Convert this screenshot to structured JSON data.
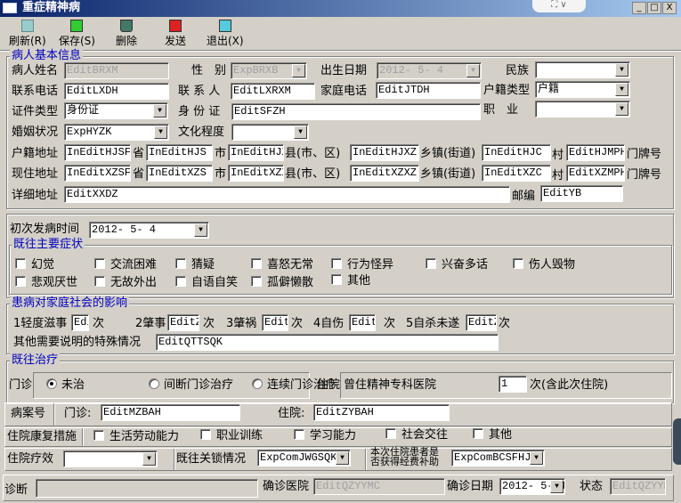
{
  "window": {
    "title": "重症精神病",
    "controls": [
      "_",
      "□",
      "X"
    ]
  },
  "toolbar": [
    {
      "label": "刷新(R)",
      "icon": "refresh-icon"
    },
    {
      "label": "保存(S)",
      "icon": "save-icon"
    },
    {
      "label": "删除",
      "icon": "trash-icon"
    },
    {
      "label": "发送",
      "icon": "send-icon"
    },
    {
      "label": "退出(X)",
      "icon": "exit-icon"
    }
  ],
  "basic": {
    "legend": "病人基本信息",
    "name_label": "病人姓名",
    "name": "EditBRXM",
    "sex_label": "性　别",
    "sex": "ExpBRXB",
    "birth_label": "出生日期",
    "birth": "2012- 5- 4",
    "nation_label": "民族",
    "nation": "",
    "phone_label": "联系电话",
    "phone": "EditLXDH",
    "contact_label": "联 系 人",
    "contact": "EditLXRXM",
    "homephone_label": "家庭电话",
    "homephone": "EditJTDH",
    "hukou_type_label": "户籍类型",
    "hukou_type": "户籍",
    "idtype_label": "证件类型",
    "idtype": "身份证",
    "id_label": "身 份 证",
    "id": "EditSFZH",
    "job_label": "职　业",
    "job": "",
    "marriage_label": "婚姻状况",
    "marriage": "ExpHYZK",
    "edu_label": "文化程度",
    "edu": "",
    "addr_units": {
      "prov": "省",
      "city": "市",
      "county": "县(市、区)",
      "town": "乡镇(街道)",
      "village": "村",
      "door": "门牌号"
    },
    "hj_label": "户籍地址",
    "hj": [
      "InEditHJSF",
      "InEditHJS",
      "InEditHJX",
      "InEditHJXZ",
      "InEditHJC",
      "EditHJMPH"
    ],
    "xz_label": "现住地址",
    "xz": [
      "InEditXZSF",
      "InEditXZS",
      "InEditXZX",
      "InEditXZXZ",
      "InEditXZC",
      "EditXZMPH"
    ],
    "detail_label": "详细地址",
    "detail": "EditXXDZ",
    "zip_label": "邮编",
    "zip": "EditYB"
  },
  "onset": {
    "label": "初次发病时间",
    "value": "2012- 5- 4"
  },
  "symptoms": {
    "legend": "既往主要症状",
    "items": [
      "幻觉",
      "交流困难",
      "猜疑",
      "喜怒无常",
      "行为怪异",
      "兴奋多话",
      "伤人毁物",
      "悲观厌世",
      "无故外出",
      "自语自笑",
      "孤僻懒散",
      "其他"
    ]
  },
  "impact": {
    "legend": "患病对家庭社会的影响",
    "unit": "次",
    "items": [
      {
        "label": "1轻度滋事",
        "value": "Edit("
      },
      {
        "label": "2肇事",
        "value": "EditZ"
      },
      {
        "label": "3肇祸",
        "value": "Edit"
      },
      {
        "label": "4自伤",
        "value": "Edit"
      },
      {
        "label": "5自杀未遂",
        "value": "EditZ"
      }
    ],
    "other_label": "其他需要说明的特殊情况",
    "other": "EditQTTSQK"
  },
  "treatment": {
    "legend": "既往治疗",
    "clinic_label": "门诊",
    "options": [
      "未治",
      "间断门诊治疗",
      "连续门诊治疗"
    ],
    "selected": "未治",
    "hosp_label": "住院",
    "hosp_text": "曾住精神专科医院",
    "hosp_count": "1",
    "hosp_suffix": "次(含此次住院)"
  },
  "record": {
    "label": "病案号",
    "clinic_label": "门诊:",
    "clinic": "EditMZBAH",
    "hosp_label": "住院:",
    "hosp": "EditZYBAH"
  },
  "rehab": {
    "label": "住院康复措施",
    "items": [
      "生活劳动能力",
      "职业训练",
      "学习能力",
      "社会交往",
      "其他"
    ]
  },
  "effect": {
    "label": "住院疗效",
    "value": "",
    "lock_label": "既往关锁情况",
    "lock": "ExpComJWGSQK",
    "subsidy_label1": "本次住院患者是",
    "subsidy_label2": "否获得经费补助",
    "subsidy": "ExpComBCSFHJF"
  },
  "diag": {
    "label": "诊断",
    "value": "",
    "hosp_label": "确诊医院",
    "hosp": "EditQZYYMC",
    "date_label": "确诊日期",
    "date": "2012- 5- 4",
    "status_label": "状态",
    "status": "EditQZYYM"
  }
}
